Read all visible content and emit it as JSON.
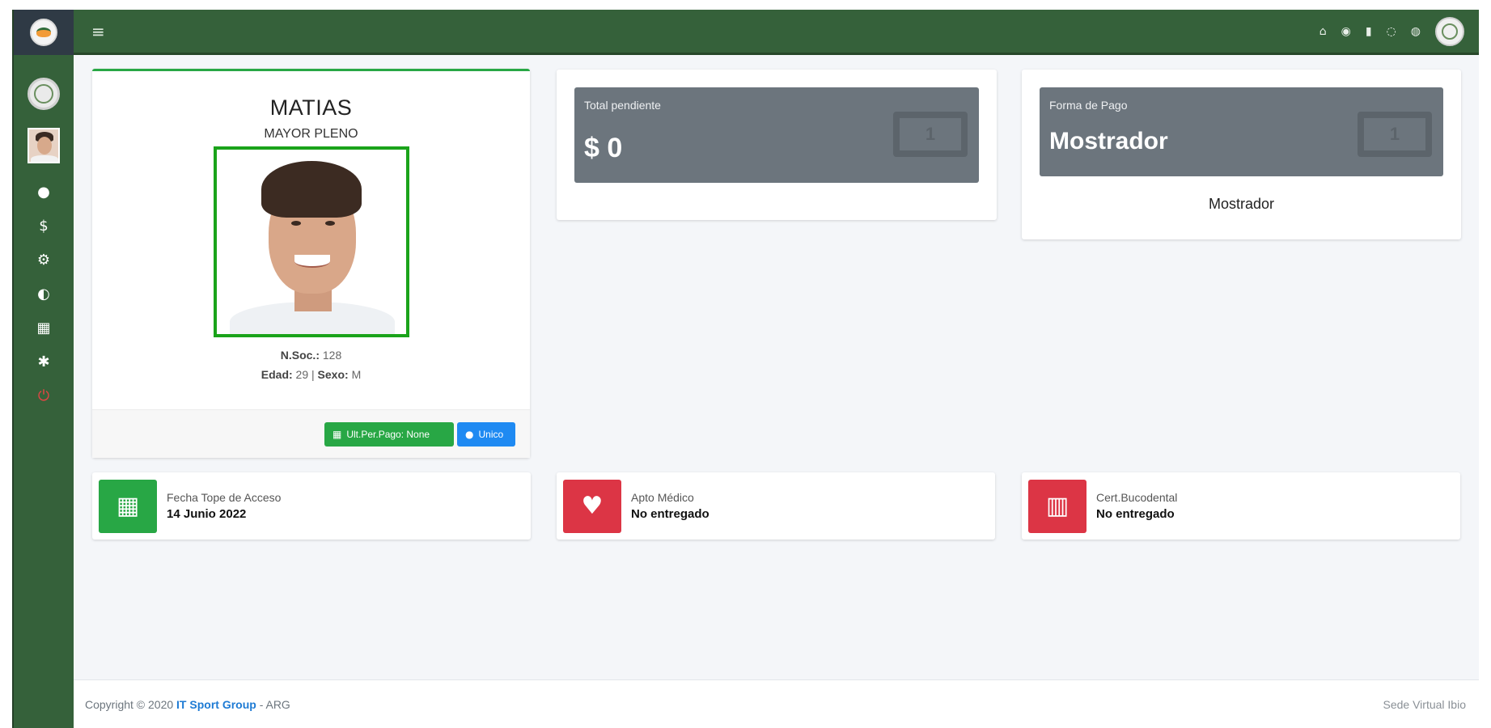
{
  "topbar": {
    "menu_icon": "hamburger-icon",
    "icons": [
      "home-icon",
      "eye-icon",
      "document-icon",
      "chat-icon",
      "messages-icon"
    ]
  },
  "sidebar": {
    "icons": [
      "info-icon",
      "dollar-icon",
      "settings-icon",
      "shield-icon",
      "calendar-icon",
      "tools-icon",
      "power-icon"
    ]
  },
  "profile": {
    "name": "MATIAS",
    "category": "MAYOR PLENO",
    "nsoc_label": "N.Soc.:",
    "nsoc_value": "128",
    "edad_label": "Edad:",
    "edad_value": "29",
    "separator": "|",
    "sexo_label": "Sexo:",
    "sexo_value": "M",
    "btn_payment": "Ult.Per.Pago: None",
    "btn_type": "Unico"
  },
  "pending": {
    "label": "Total pendiente",
    "value": "$ 0"
  },
  "payment": {
    "label": "Forma de Pago",
    "value": "Mostrador",
    "sub": "Mostrador"
  },
  "stats": [
    {
      "label": "Fecha Tope de Acceso",
      "value": "14 Junio 2022",
      "color": "#28a745",
      "icon": "calendar-icon"
    },
    {
      "label": "Apto Médico",
      "value": "No entregado",
      "color": "#dc3545",
      "icon": "heart-pulse-icon"
    },
    {
      "label": "Cert.Bucodental",
      "value": "No entregado",
      "color": "#dc3545",
      "icon": "teeth-icon"
    }
  ],
  "footer": {
    "copyright": "Copyright © 2020",
    "company": "IT Sport Group",
    "suffix": "- ARG",
    "right": "Sede Virtual Ibio"
  },
  "colors": {
    "header": "#35613a",
    "success": "#28a745",
    "danger": "#dc3545",
    "secondary": "#6c757d",
    "primary": "#1f8af2"
  }
}
